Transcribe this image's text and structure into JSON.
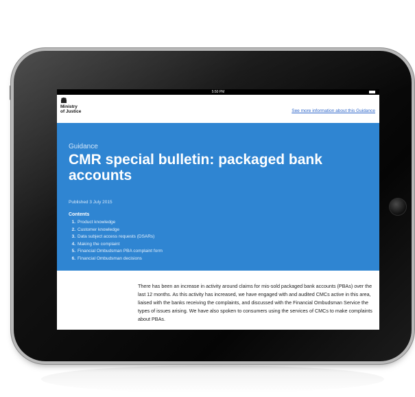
{
  "status_bar": {
    "time": "5:50 PM"
  },
  "header": {
    "logo_line1": "Ministry",
    "logo_line2": "of Justice",
    "more_info_link": "See more information about this Guidance"
  },
  "hero": {
    "kicker": "Guidance",
    "title": "CMR special bulletin: packaged bank accounts",
    "published": "Published 3 July 2015"
  },
  "contents": {
    "heading": "Contents",
    "items": [
      {
        "num": "1.",
        "label": "Product knowledge"
      },
      {
        "num": "2.",
        "label": "Customer knowledge"
      },
      {
        "num": "3.",
        "label": "Data subject access requests (DSARs)"
      },
      {
        "num": "4.",
        "label": "Making the complaint"
      },
      {
        "num": "5.",
        "label": "Financial Ombudsman PBA complaint form"
      },
      {
        "num": "6.",
        "label": "Financial Ombudsman decisions"
      }
    ]
  },
  "body": {
    "paragraph": "There has been an increase in activity around claims for mis-sold packaged bank accounts (PBAs) over the last 12 months. As this activity has increased, we have engaged with and audited CMCs active in this area, liaised with the banks receiving the complaints, and discussed with the Financial Ombudsman Service the types of issues arising. We have also spoken to consumers using the services of CMCs to make complaints about PBAs."
  },
  "colors": {
    "hero_background": "#2f85d2",
    "link": "#2b64c9",
    "device_frame": "#0a0a0a"
  }
}
